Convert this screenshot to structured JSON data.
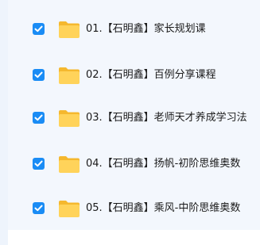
{
  "file_list": {
    "items": [
      {
        "checked": true,
        "icon": "folder-icon",
        "label": "01.【石明鑫】家长规划课"
      },
      {
        "checked": true,
        "icon": "folder-icon",
        "label": "02.【石明鑫】百例分享课程"
      },
      {
        "checked": true,
        "icon": "folder-icon",
        "label": "03.【石明鑫】老师天才养成学习法"
      },
      {
        "checked": true,
        "icon": "folder-icon",
        "label": "04.【石明鑫】扬帆-初阶思维奥数"
      },
      {
        "checked": true,
        "icon": "folder-icon",
        "label": "05.【石明鑫】乘风-中阶思维奥数"
      }
    ]
  },
  "colors": {
    "checkbox": "#1a8cf5",
    "folder_back": "#f5b82e",
    "folder_front": "#ffd35a",
    "panel_bg": "#f3f7fd"
  }
}
